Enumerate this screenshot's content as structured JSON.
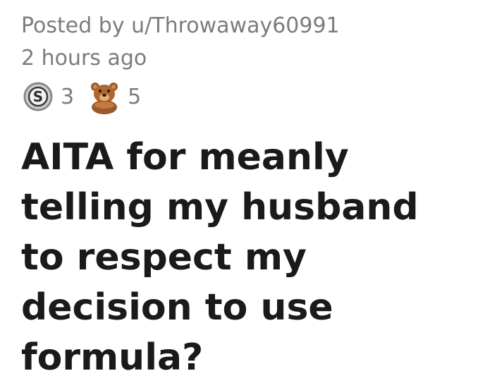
{
  "post": {
    "posted_by": "Posted by u/Throwaway60991",
    "time": "2 hours ago",
    "awards": [
      {
        "icon": "silver-award-icon",
        "count": "3"
      },
      {
        "icon": "bear-award-icon",
        "count": "5"
      }
    ],
    "title": "AITA for meanly telling my husband to respect my decision to use formula?"
  }
}
